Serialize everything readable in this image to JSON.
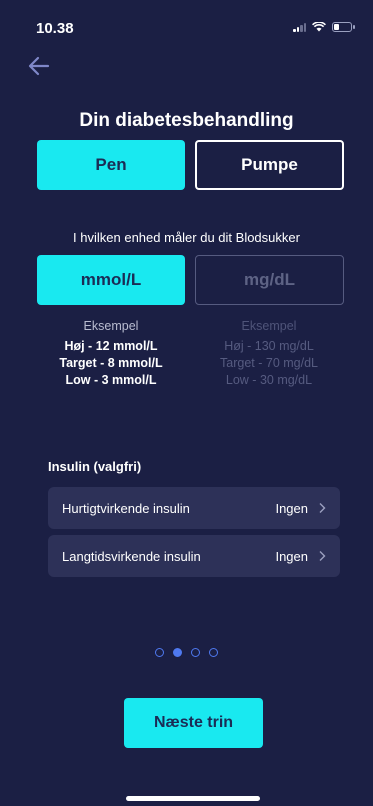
{
  "status_bar": {
    "time": "10.38"
  },
  "header": {
    "title": "Din diabetesbehandling"
  },
  "treatment": {
    "options": [
      "Pen",
      "Pumpe"
    ],
    "selected": "Pen"
  },
  "units": {
    "question": "I hvilken enhed måler du dit Blodsukker",
    "options": [
      "mmol/L",
      "mg/dL"
    ],
    "selected": "mmol/L"
  },
  "examples": {
    "mmol": {
      "heading": "Eksempel",
      "lines": [
        "Høj - 12 mmol/L",
        "Target - 8 mmol/L",
        "Low - 3 mmol/L"
      ]
    },
    "mgdl": {
      "heading": "Eksempel",
      "lines": [
        "Høj - 130 mg/dL",
        "Target - 70 mg/dL",
        "Low - 30 mg/dL"
      ]
    }
  },
  "insulin": {
    "header": "Insulin (valgfri)",
    "rows": [
      {
        "label": "Hurtigtvirkende insulin",
        "value": "Ingen"
      },
      {
        "label": "Langtidsvirkende insulin",
        "value": "Ingen"
      }
    ]
  },
  "pagination": {
    "total": 4,
    "current": 2
  },
  "footer": {
    "next_label": "Næste trin"
  },
  "colors": {
    "background": "#1b1f44",
    "accent": "#19e9f0",
    "dot": "#4f79f0"
  }
}
